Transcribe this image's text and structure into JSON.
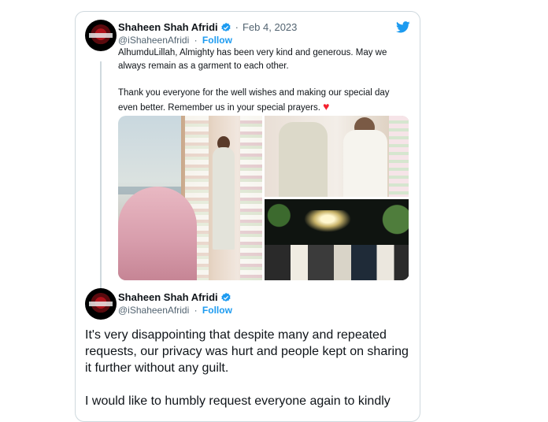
{
  "tweet1": {
    "name": "Shaheen Shah Afridi",
    "separator": "·",
    "date": "Feb 4, 2023",
    "handle": "@iShaheenAfridi",
    "dot": "·",
    "follow": "Follow",
    "para1": "AlhumduLillah, Almighty has been very kind and generous. May we always remain as a garment to each other.",
    "para2": "Thank you everyone for the well wishes and making our special day even better. Remember us in your special prayers.",
    "heart": "♥"
  },
  "tweet2": {
    "name": "Shaheen Shah Afridi",
    "handle": "@iShaheenAfridi",
    "dot": "·",
    "follow": "Follow",
    "para1": "It's very disappointing that despite many and repeated requests, our privacy was hurt and people kept on sharing it further without any guilt.",
    "para2": "I would like to humbly request everyone again to kindly"
  },
  "icons": {
    "brand": "twitter-bird-icon",
    "verified": "verified-badge-icon"
  },
  "colors": {
    "accent": "#1d9bf0",
    "text": "#0f1419",
    "muted": "#536471",
    "border": "#cfd9de",
    "heart": "#f4212e"
  }
}
